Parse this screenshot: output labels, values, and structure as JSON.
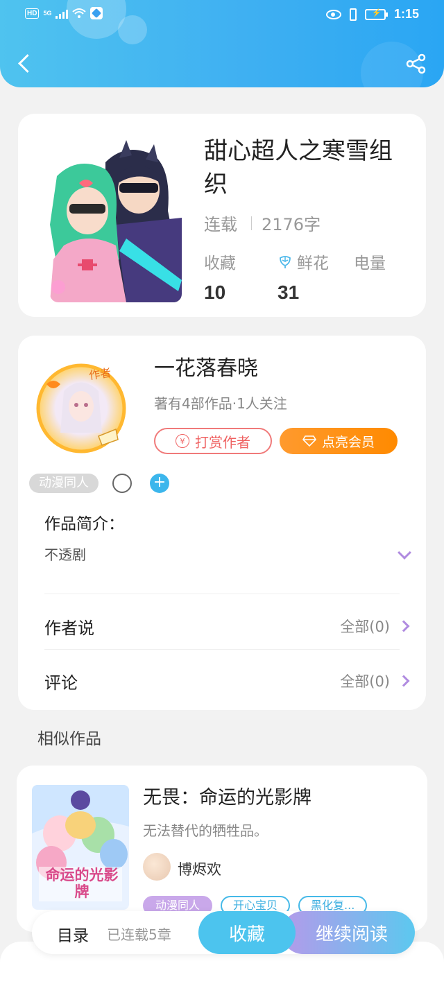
{
  "status_bar": {
    "network": "HD",
    "signal": "5G",
    "time": "1:15"
  },
  "book": {
    "title": "甜心超人之寒雪组织",
    "status": "连载",
    "word_count": "2176字",
    "stats": [
      {
        "label": "收藏",
        "value": "10"
      },
      {
        "label": "鲜花",
        "value": "31"
      },
      {
        "label": "电量",
        "value": ""
      }
    ]
  },
  "author": {
    "name": "一花落春晓",
    "avatar_badge": "作者",
    "summary": "著有4部作品·1人关注",
    "reward_label": "打赏作者",
    "vip_label": "点亮会员"
  },
  "tags": [
    "动漫同人"
  ],
  "intro": {
    "title": "作品简介：",
    "text": "不透剧"
  },
  "rows": [
    {
      "label": "作者说",
      "right": "全部(0)"
    },
    {
      "label": "评论",
      "right": "全部(0)"
    }
  ],
  "similar": {
    "section_title": "相似作品",
    "items": [
      {
        "title": "无畏：命运的光影牌",
        "desc": "无法替代的牺牲品。",
        "author": "博烬欢",
        "cover_text": "命运的光影牌",
        "tags": [
          "动漫同人",
          "开心宝贝",
          "黑化复..."
        ]
      }
    ]
  },
  "bottom_bar": {
    "toc_label": "目录",
    "chapters_label": "已连载5章",
    "collect_label": "收藏",
    "read_label": "继续阅读"
  },
  "colors": {
    "header_start": "#4fc3ef",
    "header_end": "#2aa6f3",
    "reward": "#ef6262",
    "vip": "#ff8a00",
    "accent_purple": "#b08be0",
    "accent_blue": "#4cc4ee"
  }
}
